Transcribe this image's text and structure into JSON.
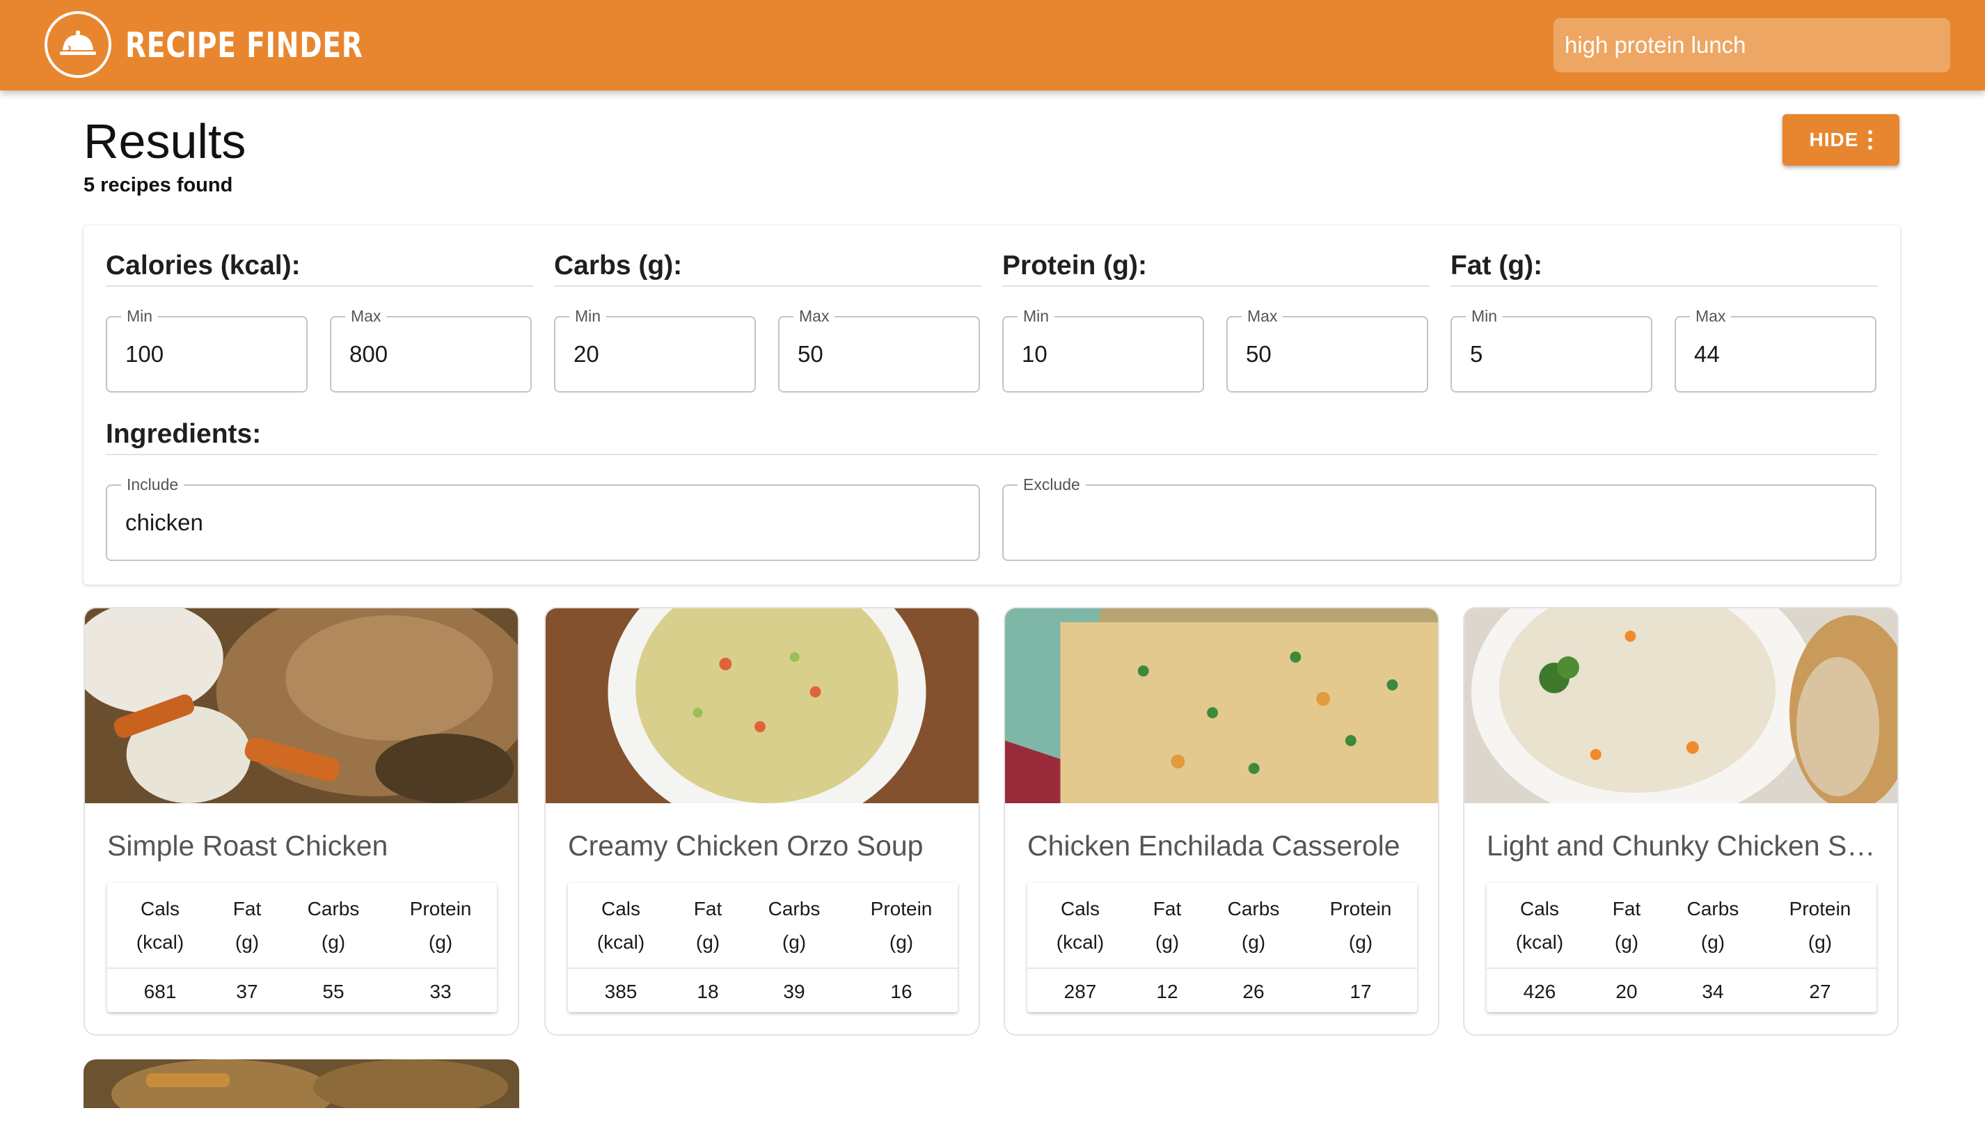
{
  "app": {
    "brand": "RECIPE FINDER"
  },
  "search": {
    "value": "high protein lunch",
    "placeholder": ""
  },
  "results": {
    "title": "Results",
    "count_text": "5 recipes found",
    "hide_label": "HIDE"
  },
  "filters": {
    "calories": {
      "label": "Calories (kcal):",
      "min_label": "Min",
      "min": "100",
      "max_label": "Max",
      "max": "800"
    },
    "carbs": {
      "label": "Carbs (g):",
      "min_label": "Min",
      "min": "20",
      "max_label": "Max",
      "max": "50"
    },
    "protein": {
      "label": "Protein (g):",
      "min_label": "Min",
      "min": "10",
      "max_label": "Max",
      "max": "50"
    },
    "fat": {
      "label": "Fat (g):",
      "min_label": "Min",
      "min": "5",
      "max_label": "Max",
      "max": "44"
    },
    "ingredients": {
      "label": "Ingredients:",
      "include_label": "Include",
      "include": "chicken",
      "exclude_label": "Exclude",
      "exclude": ""
    }
  },
  "table_headers": {
    "cals": [
      "Cals",
      "(kcal)"
    ],
    "fat": [
      "Fat",
      "(g)"
    ],
    "carbs": [
      "Carbs",
      "(g)"
    ],
    "protein": [
      "Protein",
      "(g)"
    ]
  },
  "recipes": [
    {
      "title": "Simple Roast Chicken",
      "cals": "681",
      "fat": "37",
      "carbs": "55",
      "protein": "33"
    },
    {
      "title": "Creamy Chicken Orzo Soup",
      "cals": "385",
      "fat": "18",
      "carbs": "39",
      "protein": "16"
    },
    {
      "title": "Chicken Enchilada Casserole",
      "cals": "287",
      "fat": "12",
      "carbs": "26",
      "protein": "17"
    },
    {
      "title": "Light and Chunky Chicken So...",
      "cals": "426",
      "fat": "20",
      "carbs": "34",
      "protein": "27"
    }
  ],
  "colors": {
    "accent": "#e8862f",
    "search_bg": "#eda663"
  },
  "icons": {
    "logo": "cloche-icon",
    "menu": "more-vert-icon"
  }
}
